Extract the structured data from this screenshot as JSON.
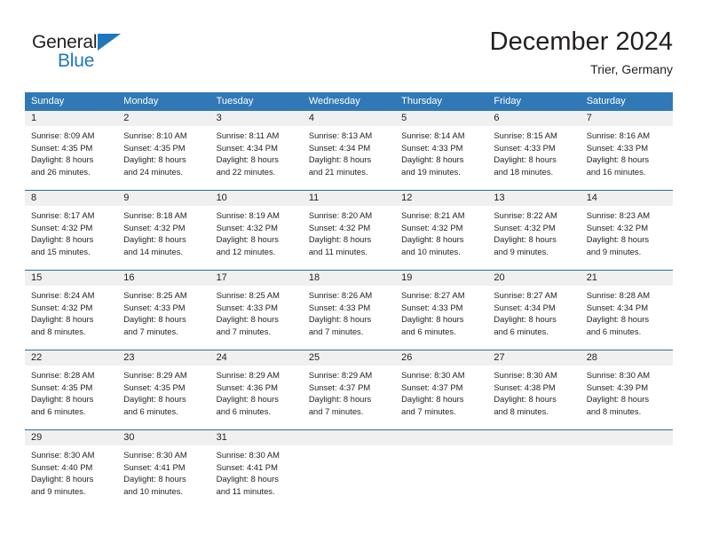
{
  "logo": {
    "word_one": "General",
    "word_two": "Blue",
    "triangle_color": "#1f77bd",
    "blue_color": "#1f77bd",
    "dark_color": "#231f20"
  },
  "header": {
    "title": "December 2024",
    "subtitle": "Trier, Germany"
  },
  "theme": {
    "header_blue": "#3179b6",
    "divider_blue": "#2b6ca3",
    "day_band_gray": "#f0f0f0",
    "text_color": "#231f20"
  },
  "weekdays": [
    "Sunday",
    "Monday",
    "Tuesday",
    "Wednesday",
    "Thursday",
    "Friday",
    "Saturday"
  ],
  "weeks": [
    [
      {
        "day": "1",
        "sunrise": "Sunrise: 8:09 AM",
        "sunset": "Sunset: 4:35 PM",
        "daylight1": "Daylight: 8 hours",
        "daylight2": "and 26 minutes."
      },
      {
        "day": "2",
        "sunrise": "Sunrise: 8:10 AM",
        "sunset": "Sunset: 4:35 PM",
        "daylight1": "Daylight: 8 hours",
        "daylight2": "and 24 minutes."
      },
      {
        "day": "3",
        "sunrise": "Sunrise: 8:11 AM",
        "sunset": "Sunset: 4:34 PM",
        "daylight1": "Daylight: 8 hours",
        "daylight2": "and 22 minutes."
      },
      {
        "day": "4",
        "sunrise": "Sunrise: 8:13 AM",
        "sunset": "Sunset: 4:34 PM",
        "daylight1": "Daylight: 8 hours",
        "daylight2": "and 21 minutes."
      },
      {
        "day": "5",
        "sunrise": "Sunrise: 8:14 AM",
        "sunset": "Sunset: 4:33 PM",
        "daylight1": "Daylight: 8 hours",
        "daylight2": "and 19 minutes."
      },
      {
        "day": "6",
        "sunrise": "Sunrise: 8:15 AM",
        "sunset": "Sunset: 4:33 PM",
        "daylight1": "Daylight: 8 hours",
        "daylight2": "and 18 minutes."
      },
      {
        "day": "7",
        "sunrise": "Sunrise: 8:16 AM",
        "sunset": "Sunset: 4:33 PM",
        "daylight1": "Daylight: 8 hours",
        "daylight2": "and 16 minutes."
      }
    ],
    [
      {
        "day": "8",
        "sunrise": "Sunrise: 8:17 AM",
        "sunset": "Sunset: 4:32 PM",
        "daylight1": "Daylight: 8 hours",
        "daylight2": "and 15 minutes."
      },
      {
        "day": "9",
        "sunrise": "Sunrise: 8:18 AM",
        "sunset": "Sunset: 4:32 PM",
        "daylight1": "Daylight: 8 hours",
        "daylight2": "and 14 minutes."
      },
      {
        "day": "10",
        "sunrise": "Sunrise: 8:19 AM",
        "sunset": "Sunset: 4:32 PM",
        "daylight1": "Daylight: 8 hours",
        "daylight2": "and 12 minutes."
      },
      {
        "day": "11",
        "sunrise": "Sunrise: 8:20 AM",
        "sunset": "Sunset: 4:32 PM",
        "daylight1": "Daylight: 8 hours",
        "daylight2": "and 11 minutes."
      },
      {
        "day": "12",
        "sunrise": "Sunrise: 8:21 AM",
        "sunset": "Sunset: 4:32 PM",
        "daylight1": "Daylight: 8 hours",
        "daylight2": "and 10 minutes."
      },
      {
        "day": "13",
        "sunrise": "Sunrise: 8:22 AM",
        "sunset": "Sunset: 4:32 PM",
        "daylight1": "Daylight: 8 hours",
        "daylight2": "and 9 minutes."
      },
      {
        "day": "14",
        "sunrise": "Sunrise: 8:23 AM",
        "sunset": "Sunset: 4:32 PM",
        "daylight1": "Daylight: 8 hours",
        "daylight2": "and 9 minutes."
      }
    ],
    [
      {
        "day": "15",
        "sunrise": "Sunrise: 8:24 AM",
        "sunset": "Sunset: 4:32 PM",
        "daylight1": "Daylight: 8 hours",
        "daylight2": "and 8 minutes."
      },
      {
        "day": "16",
        "sunrise": "Sunrise: 8:25 AM",
        "sunset": "Sunset: 4:33 PM",
        "daylight1": "Daylight: 8 hours",
        "daylight2": "and 7 minutes."
      },
      {
        "day": "17",
        "sunrise": "Sunrise: 8:25 AM",
        "sunset": "Sunset: 4:33 PM",
        "daylight1": "Daylight: 8 hours",
        "daylight2": "and 7 minutes."
      },
      {
        "day": "18",
        "sunrise": "Sunrise: 8:26 AM",
        "sunset": "Sunset: 4:33 PM",
        "daylight1": "Daylight: 8 hours",
        "daylight2": "and 7 minutes."
      },
      {
        "day": "19",
        "sunrise": "Sunrise: 8:27 AM",
        "sunset": "Sunset: 4:33 PM",
        "daylight1": "Daylight: 8 hours",
        "daylight2": "and 6 minutes."
      },
      {
        "day": "20",
        "sunrise": "Sunrise: 8:27 AM",
        "sunset": "Sunset: 4:34 PM",
        "daylight1": "Daylight: 8 hours",
        "daylight2": "and 6 minutes."
      },
      {
        "day": "21",
        "sunrise": "Sunrise: 8:28 AM",
        "sunset": "Sunset: 4:34 PM",
        "daylight1": "Daylight: 8 hours",
        "daylight2": "and 6 minutes."
      }
    ],
    [
      {
        "day": "22",
        "sunrise": "Sunrise: 8:28 AM",
        "sunset": "Sunset: 4:35 PM",
        "daylight1": "Daylight: 8 hours",
        "daylight2": "and 6 minutes."
      },
      {
        "day": "23",
        "sunrise": "Sunrise: 8:29 AM",
        "sunset": "Sunset: 4:35 PM",
        "daylight1": "Daylight: 8 hours",
        "daylight2": "and 6 minutes."
      },
      {
        "day": "24",
        "sunrise": "Sunrise: 8:29 AM",
        "sunset": "Sunset: 4:36 PM",
        "daylight1": "Daylight: 8 hours",
        "daylight2": "and 6 minutes."
      },
      {
        "day": "25",
        "sunrise": "Sunrise: 8:29 AM",
        "sunset": "Sunset: 4:37 PM",
        "daylight1": "Daylight: 8 hours",
        "daylight2": "and 7 minutes."
      },
      {
        "day": "26",
        "sunrise": "Sunrise: 8:30 AM",
        "sunset": "Sunset: 4:37 PM",
        "daylight1": "Daylight: 8 hours",
        "daylight2": "and 7 minutes."
      },
      {
        "day": "27",
        "sunrise": "Sunrise: 8:30 AM",
        "sunset": "Sunset: 4:38 PM",
        "daylight1": "Daylight: 8 hours",
        "daylight2": "and 8 minutes."
      },
      {
        "day": "28",
        "sunrise": "Sunrise: 8:30 AM",
        "sunset": "Sunset: 4:39 PM",
        "daylight1": "Daylight: 8 hours",
        "daylight2": "and 8 minutes."
      }
    ],
    [
      {
        "day": "29",
        "sunrise": "Sunrise: 8:30 AM",
        "sunset": "Sunset: 4:40 PM",
        "daylight1": "Daylight: 8 hours",
        "daylight2": "and 9 minutes."
      },
      {
        "day": "30",
        "sunrise": "Sunrise: 8:30 AM",
        "sunset": "Sunset: 4:41 PM",
        "daylight1": "Daylight: 8 hours",
        "daylight2": "and 10 minutes."
      },
      {
        "day": "31",
        "sunrise": "Sunrise: 8:30 AM",
        "sunset": "Sunset: 4:41 PM",
        "daylight1": "Daylight: 8 hours",
        "daylight2": "and 11 minutes."
      },
      {
        "day": "",
        "sunrise": "",
        "sunset": "",
        "daylight1": "",
        "daylight2": ""
      },
      {
        "day": "",
        "sunrise": "",
        "sunset": "",
        "daylight1": "",
        "daylight2": ""
      },
      {
        "day": "",
        "sunrise": "",
        "sunset": "",
        "daylight1": "",
        "daylight2": ""
      },
      {
        "day": "",
        "sunrise": "",
        "sunset": "",
        "daylight1": "",
        "daylight2": ""
      }
    ]
  ]
}
